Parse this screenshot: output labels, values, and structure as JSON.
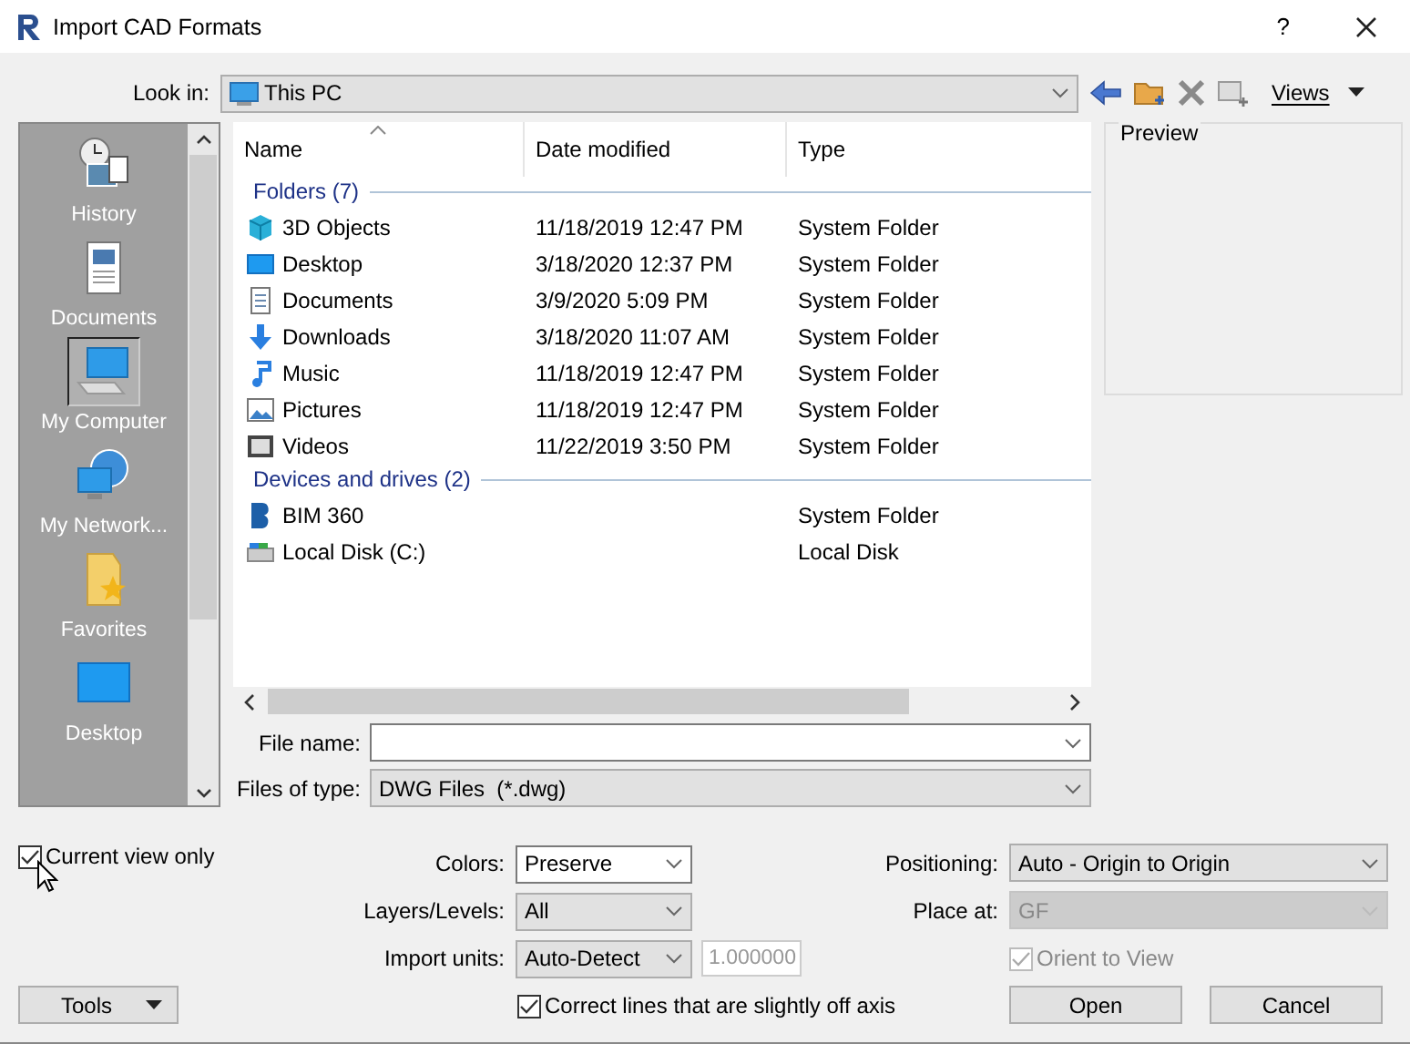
{
  "window": {
    "title": "Import CAD Formats",
    "help": "?"
  },
  "look_in": {
    "label": "Look in:",
    "value": "This PC"
  },
  "toolbar": {
    "views": "Views"
  },
  "places": [
    {
      "label": "History",
      "kind": "history",
      "selected": false
    },
    {
      "label": "Documents",
      "kind": "documents",
      "selected": false
    },
    {
      "label": "My Computer",
      "kind": "computer",
      "selected": true
    },
    {
      "label": "My Network...",
      "kind": "network",
      "selected": false
    },
    {
      "label": "Favorites",
      "kind": "favorites",
      "selected": false
    },
    {
      "label": "Desktop",
      "kind": "desktop",
      "selected": false
    }
  ],
  "table": {
    "columns": [
      "Name",
      "Date modified",
      "Type"
    ],
    "groups": [
      {
        "label": "Folders (7)",
        "rows": [
          {
            "name": "3D Objects",
            "date": "11/18/2019 12:47 PM",
            "type": "System Folder",
            "kind": "cube"
          },
          {
            "name": "Desktop",
            "date": "3/18/2020 12:37 PM",
            "type": "System Folder",
            "kind": "desktop"
          },
          {
            "name": "Documents",
            "date": "3/9/2020 5:09 PM",
            "type": "System Folder",
            "kind": "documents"
          },
          {
            "name": "Downloads",
            "date": "3/18/2020 11:07 AM",
            "type": "System Folder",
            "kind": "download"
          },
          {
            "name": "Music",
            "date": "11/18/2019 12:47 PM",
            "type": "System Folder",
            "kind": "music"
          },
          {
            "name": "Pictures",
            "date": "11/18/2019 12:47 PM",
            "type": "System Folder",
            "kind": "pictures"
          },
          {
            "name": "Videos",
            "date": "11/22/2019 3:50 PM",
            "type": "System Folder",
            "kind": "videos"
          }
        ]
      },
      {
        "label": "Devices and drives (2)",
        "rows": [
          {
            "name": "BIM 360",
            "type": "System Folder",
            "kind": "bim"
          },
          {
            "name": "Local Disk (C:)",
            "type": "Local Disk",
            "kind": "disk"
          }
        ]
      }
    ]
  },
  "preview": {
    "label": "Preview"
  },
  "file_name": {
    "label": "File name:"
  },
  "files_of_type": {
    "label": "Files of type:",
    "value": "DWG Files  (*.dwg)"
  },
  "current_view_only": {
    "label": "Current view only",
    "checked": true
  },
  "fields": [
    {
      "label": "Colors:",
      "value": "Preserve",
      "editable": true
    },
    {
      "label": "Layers/Levels:",
      "value": "All",
      "editable": false
    },
    {
      "label": "Import units:",
      "value": "Auto-Detect",
      "editable": false
    }
  ],
  "scale": {
    "value": "1.000000",
    "disabled": true
  },
  "correct_lines": {
    "label": "Correct lines that are slightly off axis",
    "checked": true,
    "disabled": false
  },
  "positioning": {
    "label": "Positioning:",
    "value": "Auto - Origin to Origin",
    "disabled": false
  },
  "place_at": {
    "label": "Place at:",
    "value": "GF",
    "disabled": true
  },
  "orient_to_view": {
    "label": "Orient to View",
    "checked": true,
    "disabled": true
  },
  "buttons": {
    "tools": "Tools",
    "open": "Open",
    "cancel": "Cancel"
  }
}
